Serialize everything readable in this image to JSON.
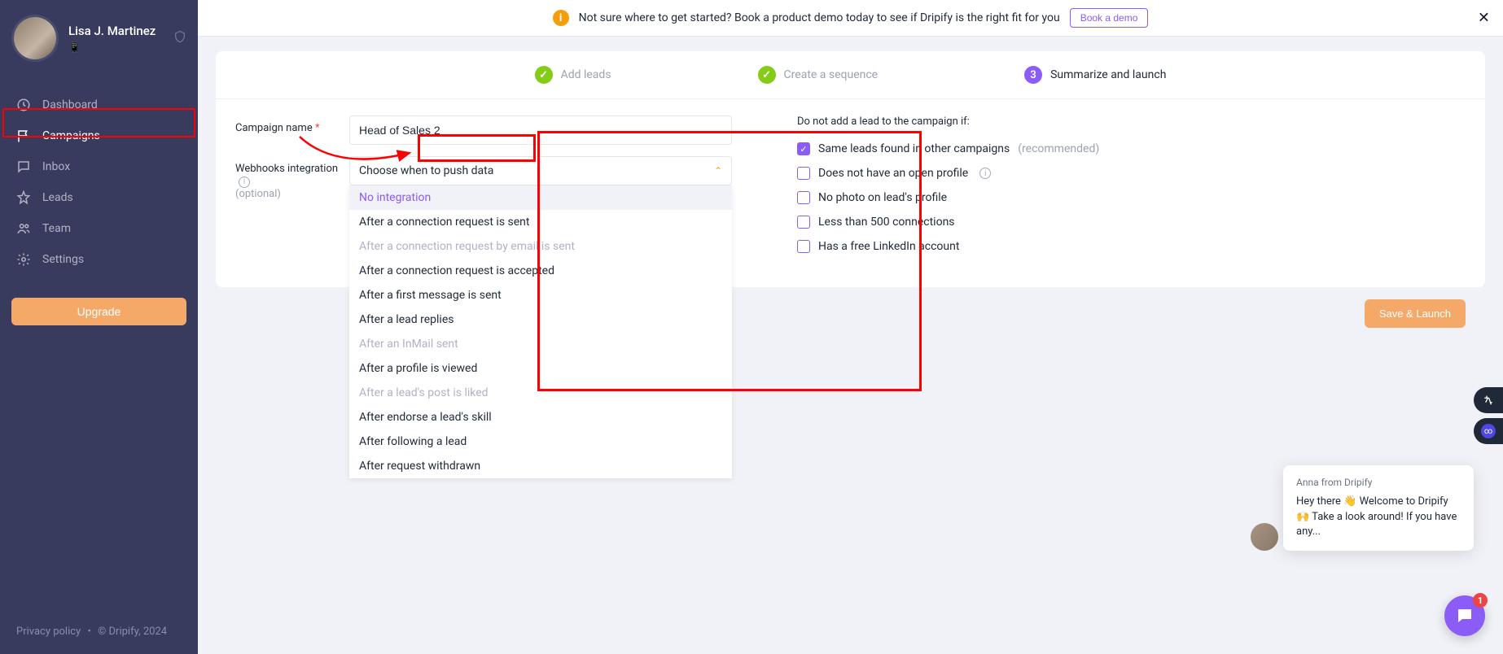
{
  "profile": {
    "name": "Lisa J. Martinez",
    "linkedin_icon": "📱"
  },
  "nav": {
    "items": [
      {
        "label": "Dashboard",
        "icon": "clock"
      },
      {
        "label": "Campaigns",
        "icon": "flag",
        "active": true
      },
      {
        "label": "Inbox",
        "icon": "message"
      },
      {
        "label": "Leads",
        "icon": "star"
      },
      {
        "label": "Team",
        "icon": "users"
      },
      {
        "label": "Settings",
        "icon": "gear"
      }
    ],
    "upgrade": "Upgrade"
  },
  "footer": {
    "privacy": "Privacy policy",
    "copyright": "© Dripify, 2024"
  },
  "banner": {
    "text": "Not sure where to get started? Book a product demo today to see if Dripify is the right fit for you",
    "button": "Book a demo"
  },
  "stepper": {
    "step1": "Add leads",
    "step2": "Create a sequence",
    "step3_num": "3",
    "step3": "Summarize and launch"
  },
  "form": {
    "campaign_label": "Campaign name",
    "campaign_value": "Head of Sales 2",
    "webhook_label": "Webhooks integration",
    "webhook_optional": "(optional)",
    "select_placeholder": "Choose when to push data",
    "options": [
      {
        "label": "No integration",
        "selected": true
      },
      {
        "label": "After a connection request is sent"
      },
      {
        "label": "After a connection request by email is sent",
        "disabled": true
      },
      {
        "label": "After a connection request is accepted"
      },
      {
        "label": "After a first message is sent"
      },
      {
        "label": "After a lead replies"
      },
      {
        "label": "After an InMail sent",
        "disabled": true
      },
      {
        "label": "After a profile is viewed"
      },
      {
        "label": "After a lead's post is liked",
        "disabled": true
      },
      {
        "label": "After endorse a lead's skill"
      },
      {
        "label": "After following a lead"
      },
      {
        "label": "After request withdrawn"
      }
    ]
  },
  "exclude": {
    "title": "Do not add a lead to the campaign if:",
    "rec": "(recommended)",
    "items": [
      {
        "label": "Same leads found in other campaigns",
        "checked": true,
        "rec": true
      },
      {
        "label": "Does not have an open profile",
        "info": true
      },
      {
        "label": "No photo on lead's profile"
      },
      {
        "label": "Less than 500 connections"
      },
      {
        "label": "Has a free LinkedIn account"
      }
    ]
  },
  "save_button": "Save & Launch",
  "chat": {
    "from": "Anna from Dripify",
    "body": "Hey there 👋 Welcome to Dripify 🙌 Take a look around! If you have any...",
    "badge": "1"
  }
}
